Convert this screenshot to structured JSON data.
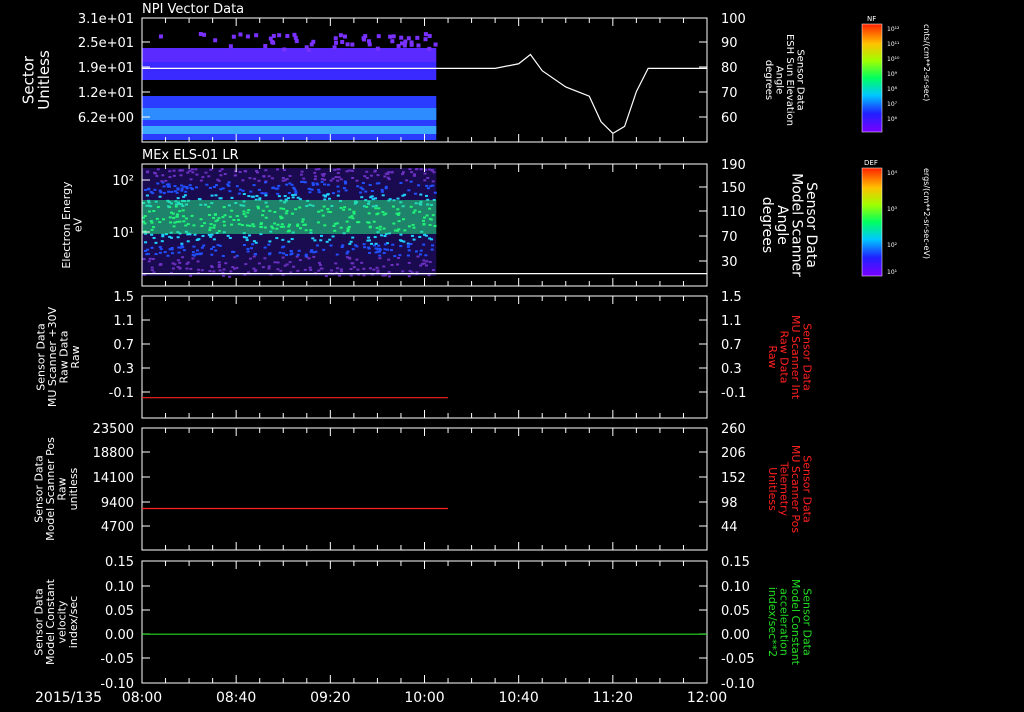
{
  "date_label": "2015/135",
  "time_ticks": [
    "08:00",
    "08:40",
    "09:20",
    "10:00",
    "10:40",
    "11:20",
    "12:00"
  ],
  "colors": {
    "white": "#ffffff",
    "red": "#ff2020",
    "green": "#22dd22"
  },
  "colorbars": [
    {
      "label": "NF",
      "units": "cnts/(cm**2-sr-sec)",
      "tick_labels": [
        "10¹²",
        "10¹¹",
        "10¹⁰",
        "10⁹",
        "10⁸",
        "10⁷",
        "10⁶"
      ]
    },
    {
      "label": "DEF",
      "units": "ergs/(cm**2-sr-sec-eV)",
      "tick_labels": [
        "10⁴",
        "10³",
        "10²",
        "10¹"
      ]
    }
  ],
  "chart_data": [
    {
      "type": "heatmap",
      "title": "NPI Vector Data",
      "ylabel": [
        "Sector",
        "Unitless"
      ],
      "y_ticks": [
        "3.1e+01",
        "2.5e+01",
        "1.9e+01",
        "1.2e+01",
        "6.2e+00"
      ],
      "right_ylabel": [
        "Sensor Data",
        "ESH Sun Elevation",
        "Angle",
        "degrees"
      ],
      "right_ticks": [
        "100",
        "90",
        "80",
        "70",
        "60"
      ],
      "right_ylim": [
        50,
        100
      ],
      "overlay_line": {
        "x": [
          "08:00",
          "10:30",
          "10:40",
          "10:45",
          "10:50",
          "11:00",
          "11:10",
          "11:15",
          "11:20",
          "11:25",
          "11:30",
          "11:35",
          "12:00"
        ],
        "y": [
          80,
          80,
          82,
          86,
          79,
          72,
          68,
          57,
          52,
          55,
          70,
          80,
          80
        ]
      }
    },
    {
      "type": "heatmap",
      "title": "MEx ELS-01 LR",
      "ylabel": [
        "Electron Energy",
        "eV"
      ],
      "y_ticks": [
        "10²",
        "10¹"
      ],
      "right_ylabel": [
        "Sensor Data",
        "Model Scanner",
        "Angle",
        "degrees"
      ],
      "right_ticks": [
        "190",
        "150",
        "110",
        "70",
        "30"
      ],
      "right_ylim": [
        0,
        190
      ],
      "overlay_line": {
        "x": [
          "08:00",
          "12:00"
        ],
        "y": [
          14,
          14
        ]
      }
    },
    {
      "type": "line",
      "ylabel": [
        "Sensor Data",
        "MU Scanner +30V",
        "Raw Data",
        "Raw"
      ],
      "y_ticks": [
        "1.5",
        "1.1",
        "0.7",
        "0.3",
        "-0.1"
      ],
      "ylim": [
        -0.3,
        1.5
      ],
      "right_ylabel": [
        "Sensor Data",
        "MU Scanner Int",
        "Raw Data",
        "Raw"
      ],
      "right_ticks": [
        "1.5",
        "1.1",
        "0.7",
        "0.3",
        "-0.1"
      ],
      "series": [
        {
          "x": [
            "08:00",
            "10:10"
          ],
          "y": [
            0,
            0
          ],
          "color": "#ff2020"
        }
      ]
    },
    {
      "type": "line",
      "ylabel": [
        "Sensor Data",
        "Model Scanner Pos",
        "Raw",
        "unitless"
      ],
      "y_ticks": [
        "23500",
        "18800",
        "14100",
        "9400",
        "4700"
      ],
      "ylim": [
        0,
        23500
      ],
      "right_ylabel": [
        "Sensor Data",
        "MU Scanner Pos",
        "Telemetry",
        "Unitless"
      ],
      "right_ticks": [
        "260",
        "206",
        "152",
        "98",
        "44"
      ],
      "series": [
        {
          "x": [
            "08:00",
            "10:10"
          ],
          "y": [
            8000,
            8000
          ],
          "color": "#ff2020"
        }
      ]
    },
    {
      "type": "line",
      "ylabel": [
        "Sensor Data",
        "Model Constant",
        "velocity",
        "index/sec"
      ],
      "y_ticks": [
        "0.15",
        "0.10",
        "0.05",
        "0.00",
        "-0.05",
        "-0.10"
      ],
      "ylim": [
        -0.1,
        0.15
      ],
      "right_ylabel": [
        "Sensor Data",
        "Model Constant",
        "acceleration",
        "index/sec**2"
      ],
      "right_ticks": [
        "0.15",
        "0.10",
        "0.05",
        "0.00",
        "-0.05",
        "-0.10"
      ],
      "series": [
        {
          "x": [
            "08:00",
            "12:00"
          ],
          "y": [
            0,
            0
          ],
          "color": "#22dd22"
        }
      ]
    }
  ]
}
